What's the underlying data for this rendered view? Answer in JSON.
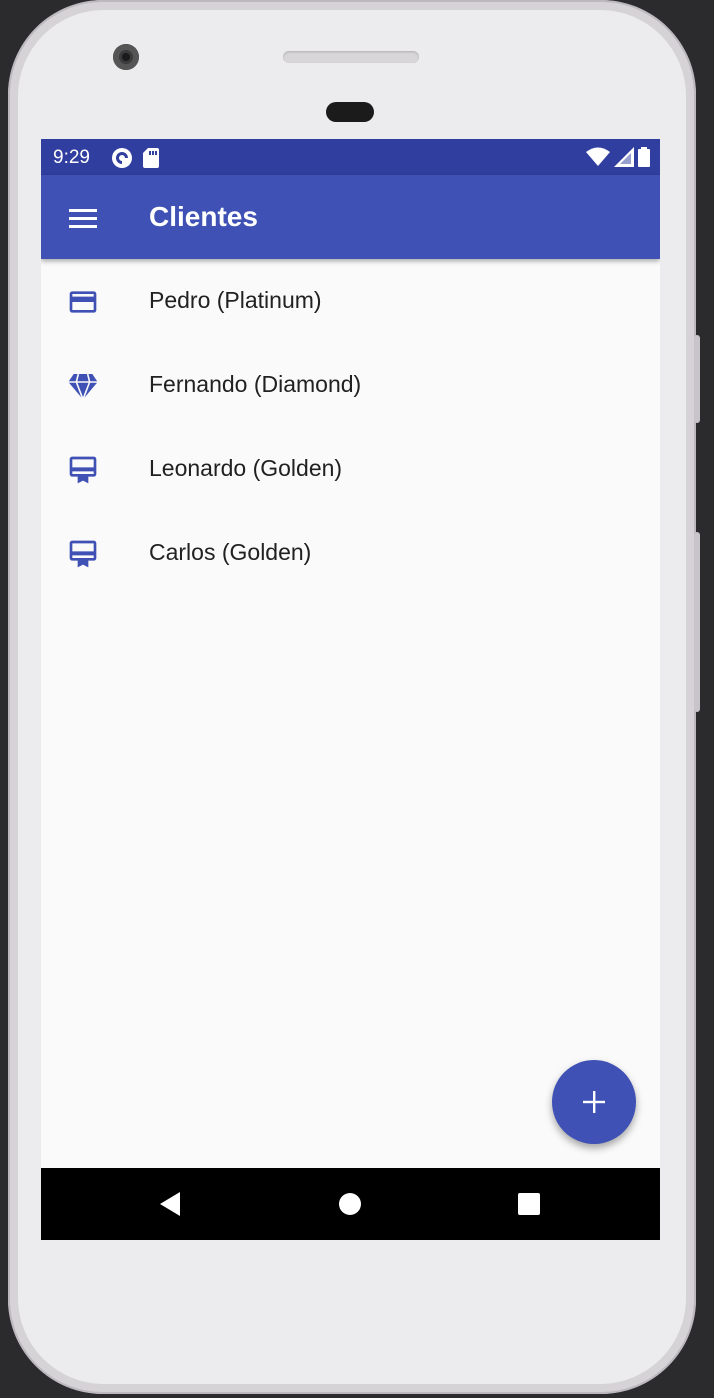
{
  "status_bar": {
    "time": "9:29",
    "icons_left": [
      "pocket-casts-icon",
      "sd-card-icon"
    ],
    "icons_right": [
      "wifi-icon",
      "signal-icon",
      "battery-icon"
    ],
    "background": "#303f9f"
  },
  "app_bar": {
    "menu_icon": "menu-icon",
    "title": "Clientes",
    "background": "#3f51b5"
  },
  "clients": [
    {
      "label": "Pedro (Platinum)",
      "icon": "credit-card-icon"
    },
    {
      "label": "Fernando (Diamond)",
      "icon": "diamond-icon"
    },
    {
      "label": "Leonardo (Golden)",
      "icon": "card-membership-icon"
    },
    {
      "label": "Carlos (Golden)",
      "icon": "card-membership-icon"
    }
  ],
  "fab": {
    "icon": "add-icon",
    "color": "#3f51b5"
  },
  "nav_bar": {
    "buttons": [
      "back-icon",
      "home-icon",
      "recents-icon"
    ]
  },
  "colors": {
    "accent": "#3f51b5",
    "icon": "#3f51b5",
    "text": "#212121",
    "background": "#fafafa"
  }
}
